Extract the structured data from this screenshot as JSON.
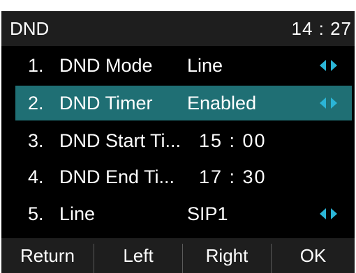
{
  "header": {
    "title": "DND",
    "clock": "14 : 27"
  },
  "menu": {
    "items": [
      {
        "number": "1.",
        "label": "DND Mode",
        "value": "Line",
        "has_arrows": true,
        "selected": false
      },
      {
        "number": "2.",
        "label": "DND Timer",
        "value": "Enabled",
        "has_arrows": true,
        "selected": true
      },
      {
        "number": "3.",
        "label": "DND Start Ti...",
        "value": "15 : 00",
        "has_arrows": false,
        "selected": false
      },
      {
        "number": "4.",
        "label": "DND End Ti...",
        "value": "17 : 30",
        "has_arrows": false,
        "selected": false
      },
      {
        "number": "5.",
        "label": "Line",
        "value": "SIP1",
        "has_arrows": true,
        "selected": false
      }
    ]
  },
  "softkeys": [
    "Return",
    "Left",
    "Right",
    "OK"
  ],
  "colors": {
    "header_bg": "#1e1e1e",
    "list_bg": "#000000",
    "selected_bg": "#1f6f74",
    "arrow": "#2bb5d6",
    "text": "#ffffff"
  },
  "icons": {
    "left_arrow": "triangle-left-icon",
    "right_arrow": "triangle-right-icon"
  }
}
